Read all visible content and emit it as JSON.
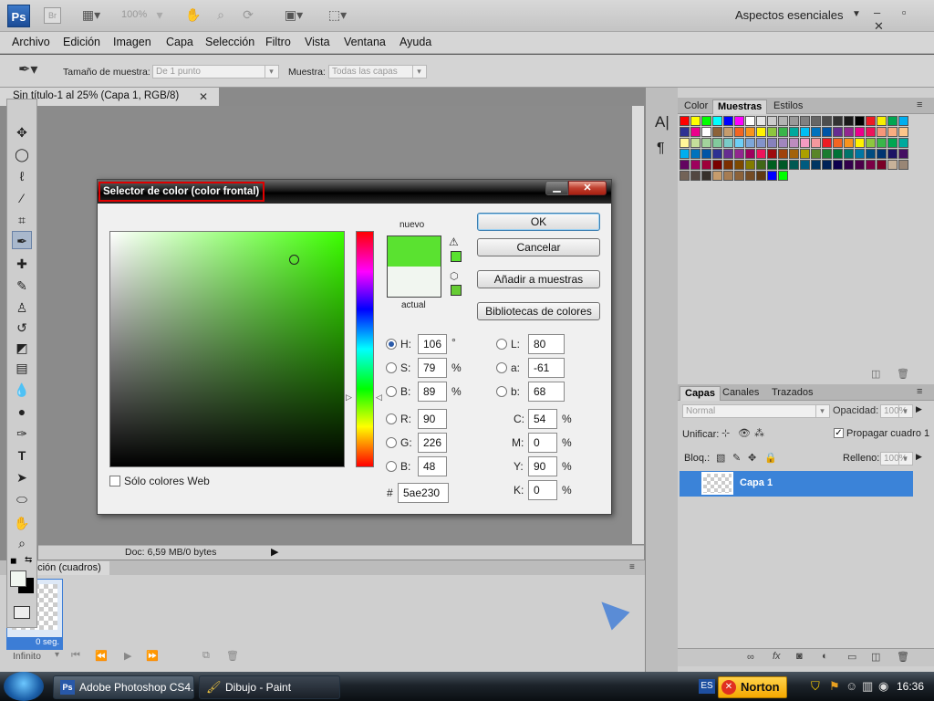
{
  "appbar": {
    "logo": "Ps",
    "bridge_logo": "Br",
    "zoom": "100%",
    "workspace": "Aspectos esenciales",
    "window_controls": "– ▫ ✕"
  },
  "menubar": [
    "Archivo",
    "Edición",
    "Imagen",
    "Capa",
    "Selección",
    "Filtro",
    "Vista",
    "Ventana",
    "Ayuda"
  ],
  "options": {
    "sample_size_label": "Tamaño de muestra:",
    "sample_size_value": "De 1 punto",
    "sample_label": "Muestra:",
    "sample_value": "Todas las capas"
  },
  "document": {
    "tab_title": "Sin título-1 al 25% (Capa 1, RGB/8)",
    "close": "✕",
    "status": "Doc: 6,59 MB/0 bytes"
  },
  "animation": {
    "tab": "ación (cuadros)",
    "frame_time": "0 seg.",
    "loop": "Infinito"
  },
  "swatch_panel": {
    "tabs": [
      "Color",
      "Muestras",
      "Estilos"
    ],
    "active": "Muestras",
    "colors": [
      "#ff0000",
      "#ffff00",
      "#00ff00",
      "#00ffff",
      "#0000ff",
      "#ff00ff",
      "#ffffff",
      "#e6e6e6",
      "#cccccc",
      "#b3b3b3",
      "#999999",
      "#808080",
      "#666666",
      "#4d4d4d",
      "#333333",
      "#1a1a1a",
      "#000000",
      "#ed1c24",
      "#f7ef00",
      "#00a651",
      "#00aeef",
      "#2e3192",
      "#ec008c",
      "#ffffff",
      "#8c6239",
      "#c69c6d",
      "#f26522",
      "#f7941d",
      "#fff200",
      "#8dc63f",
      "#39b54a",
      "#00a99d",
      "#00bff3",
      "#0072bc",
      "#0054a6",
      "#662d91",
      "#92278f",
      "#ec008c",
      "#ed145b",
      "#f69679",
      "#f9ad81",
      "#fdc68a",
      "#fff799",
      "#c4df9b",
      "#a3d39c",
      "#82ca9d",
      "#7accc8",
      "#6dcff6",
      "#7da7d9",
      "#8393ca",
      "#8781bd",
      "#a186be",
      "#bd8cbf",
      "#f49ac1",
      "#f5989d",
      "#ed1c24",
      "#f26522",
      "#f7941d",
      "#fff200",
      "#8dc63f",
      "#39b54a",
      "#00a651",
      "#00a99d",
      "#00aeef",
      "#0072bc",
      "#0054a6",
      "#2e3192",
      "#662d91",
      "#92278f",
      "#9e005d",
      "#ed145b",
      "#9e0b0f",
      "#a0410d",
      "#a3620a",
      "#aba000",
      "#598527",
      "#1a7b30",
      "#007236",
      "#00746b",
      "#0076a3",
      "#004b80",
      "#003471",
      "#1b1464",
      "#440e62",
      "#630460",
      "#9e005d",
      "#9e0039",
      "#790000",
      "#7b2e00",
      "#7d4900",
      "#827b00",
      "#406618",
      "#005e20",
      "#005826",
      "#005952",
      "#005b7f",
      "#003663",
      "#002157",
      "#0d004c",
      "#32004b",
      "#4b0049",
      "#7b0046",
      "#7a0026",
      "#c7b299",
      "#998675",
      "#736357",
      "#534741",
      "#37302a",
      "#c69c6d",
      "#a67c52",
      "#8c6239",
      "#754c24",
      "#603913",
      "#0000ff",
      "#00ff00"
    ]
  },
  "layers_panel": {
    "tabs": [
      "Capas",
      "Canales",
      "Trazados"
    ],
    "active": "Capas",
    "blend": "Normal",
    "opacity_label": "Opacidad:",
    "opacity": "100%",
    "unify_label": "Unificar:",
    "propagate": "Propagar cuadro 1",
    "lock_label": "Bloq.:",
    "fill_label": "Relleno:",
    "fill": "100%",
    "layer_name": "Capa 1"
  },
  "dialog": {
    "title": "Selector de color (color frontal)",
    "new_label": "nuevo",
    "current_label": "actual",
    "new_color": "#5ae230",
    "current_color": "#f1f6f0",
    "buttons": {
      "ok": "OK",
      "cancel": "Cancelar",
      "add": "Añadir a muestras",
      "libraries": "Bibliotecas de colores"
    },
    "web_only": "Sólo colores Web",
    "hsb": {
      "h_label": "H:",
      "h": "106",
      "h_unit": "°",
      "s_label": "S:",
      "s": "79",
      "s_unit": "%",
      "b_label": "B:",
      "b": "89",
      "b_unit": "%"
    },
    "rgb": {
      "r_label": "R:",
      "r": "90",
      "g_label": "G:",
      "g": "226",
      "b_label": "B:",
      "b": "48"
    },
    "lab": {
      "l_label": "L:",
      "l": "80",
      "a_label": "a:",
      "a": "-61",
      "b_label": "b:",
      "b": "68"
    },
    "cmyk": {
      "c_label": "C:",
      "c": "54",
      "m_label": "M:",
      "m": "0",
      "y_label": "Y:",
      "y": "90",
      "k_label": "K:",
      "k": "0",
      "unit": "%"
    },
    "hex_label": "#",
    "hex": "5ae230"
  },
  "taskbar": {
    "items": [
      "Adobe Photoshop CS4...",
      "Dibujo - Paint"
    ],
    "lang": "ES",
    "norton": "Norton",
    "clock": "16:36"
  }
}
